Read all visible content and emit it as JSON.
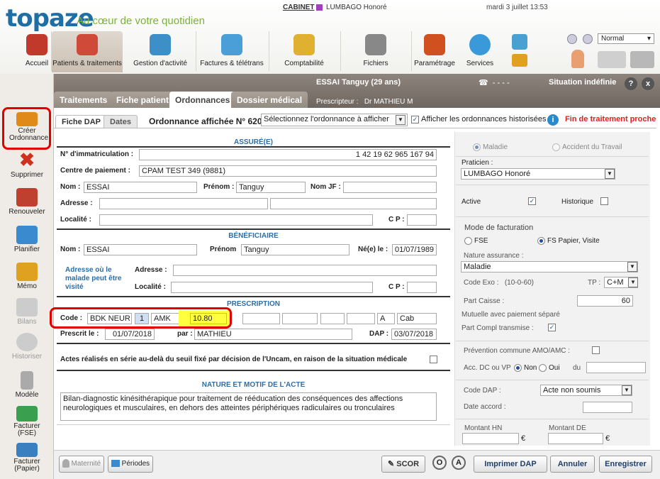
{
  "header": {
    "logo": "topaze",
    "tagline": "Au cœur de votre quotidien",
    "cabinet_label": "CABINET",
    "cabinet_user": "LUMBAGO Honoré",
    "date": "mardi 3 juillet 13:53",
    "mode": "Normal",
    "nav": [
      {
        "label": "Accueil",
        "icon": "home-icon",
        "color": "#c0392b"
      },
      {
        "label": "Patients & traitements",
        "icon": "patients-icon",
        "color": "#d04a3a"
      },
      {
        "label": "Gestion d'activité",
        "icon": "pen-icon",
        "color": "#3c8fc7"
      },
      {
        "label": "Factures & télétrans",
        "icon": "invoices-icon",
        "color": "#4a9fd8"
      },
      {
        "label": "Comptabilité",
        "icon": "accounting-icon",
        "color": "#e0b030"
      },
      {
        "label": "Fichiers",
        "icon": "files-icon",
        "color": "#888888"
      },
      {
        "label": "Paramétrage",
        "icon": "settings-icon",
        "color": "#d05020"
      },
      {
        "label": "Services",
        "icon": "globe-icon",
        "color": "#3a9ad9"
      }
    ]
  },
  "patient": {
    "name": "ESSAI Tanguy (29 ans)",
    "prescriber_label": "Prescripteur :",
    "prescriber": "Dr MATHIEU M",
    "phone": "- - - -",
    "situation": "Situation indéfinie",
    "help": "?",
    "close": "x"
  },
  "tabs": [
    "Traitements",
    "Fiche patient",
    "Ordonnances",
    "Dossier médical"
  ],
  "sidebar": [
    {
      "label": "Créer Ordonnance",
      "icon": "create-prescription-icon",
      "color": "#e08a1a"
    },
    {
      "label": "Supprimer",
      "icon": "delete-icon",
      "color": "#d03020"
    },
    {
      "label": "Renouveler",
      "icon": "renew-icon",
      "color": "#c04030"
    },
    {
      "label": "Planifier",
      "icon": "calendar-icon",
      "color": "#3a8ad0"
    },
    {
      "label": "Mémo",
      "icon": "memo-icon",
      "color": "#e0a020"
    },
    {
      "label": "Bilans",
      "icon": "reports-icon",
      "color": "#bbbbbb"
    },
    {
      "label": "Historiser",
      "icon": "history-icon",
      "color": "#bbbbbb"
    },
    {
      "label": "Modèle",
      "icon": "template-icon",
      "color": "#999999"
    },
    {
      "label": "Facturer (FSE)",
      "icon": "bill-fse-icon",
      "color": "#3aa050"
    },
    {
      "label": "Facturer (Papier)",
      "icon": "bill-paper-icon",
      "color": "#3a80c0"
    }
  ],
  "subtabs": [
    "Fiche DAP",
    "Dates"
  ],
  "ordonnance": {
    "title": "Ordonnance affichée N° 620",
    "select_placeholder": "Sélectionnez l'ordonnance à afficher",
    "show_history": "Afficher les ordonnances historisées",
    "warning": "Fin de traitement proche"
  },
  "assure": {
    "section": "ASSURÉ(E)",
    "immat_label": "N° d'immatriculation :",
    "immat": "1 42 19 62 965 167 94",
    "centre_label": "Centre de paiement :",
    "centre": "CPAM TEST 349 (9881)",
    "nom_label": "Nom :",
    "nom": "ESSAI",
    "prenom_label": "Prénom :",
    "prenom": "Tanguy",
    "nomjf_label": "Nom JF :",
    "nomjf": "",
    "adresse_label": "Adresse :",
    "localite_label": "Localité :",
    "cp_label": "C P :"
  },
  "beneficiaire": {
    "section": "BÉNÉFICIAIRE",
    "nom_label": "Nom :",
    "nom": "ESSAI",
    "prenom_label": "Prénom",
    "prenom": "Tanguy",
    "nele_label": "Né(e) le :",
    "nele": "01/07/1989",
    "where_label": "Adresse où le malade peut être visité",
    "adresse_label": "Adresse :",
    "localite_label": "Localité :",
    "cp_label": "C P :"
  },
  "prescription": {
    "section": "PRESCRIPTION",
    "code_label": "Code :",
    "code": "BDK NEUR",
    "code_num": "1",
    "amk": "AMK",
    "amount": "10.80",
    "a": "A",
    "cab": "Cab",
    "prescrit_label": "Prescrit le :",
    "prescrit": "01/07/2018",
    "par_label": "par :",
    "par": "MATHIEU",
    "dap_label": "DAP :",
    "dap": "03/07/2018",
    "serie": "Actes réalisés en série au-delà du seuil fixé par décision de l'Uncam, en raison de la situation médicale"
  },
  "nature": {
    "section": "NATURE ET MOTIF DE L'ACTE",
    "text": "Bilan-diagnostic kinésithérapique pour traitement de rééducation des conséquences des affections neurologiques et musculaires, en dehors des atteintes périphériques radiculaires ou tronculaires"
  },
  "right": {
    "maladie": "Maladie",
    "accident": "Accident du Travail",
    "praticien_label": "Praticien :",
    "praticien": "LUMBAGO Honoré",
    "active": "Active",
    "historique": "Historique",
    "mode_fact": "Mode de facturation",
    "fse": "FSE",
    "fs_papier": "FS Papier, Visite",
    "nature_label": "Nature assurance :",
    "nature": "Maladie",
    "code_exo_label": "Code Exo :",
    "code_exo": "(10-0-60)",
    "tp_label": "TP :",
    "tp": "C+M",
    "part_caisse_label": "Part Caisse :",
    "part_caisse": "60",
    "mutuelle": "Mutuelle avec paiement séparé",
    "part_compl": "Part Compl transmise :",
    "prevention": "Prévention commune AMO/AMC :",
    "acc_label": "Acc. DC ou VP",
    "non": "Non",
    "oui": "Oui",
    "du": "du",
    "code_dap_label": "Code DAP :",
    "code_dap": "Acte non soumis",
    "date_accord_label": "Date accord :",
    "montant_hn": "Montant HN",
    "montant_de": "Montant DE",
    "euro": "€"
  },
  "footer": {
    "maternite": "Maternité",
    "periodes": "Périodes",
    "scor": "SCOR",
    "o": "O",
    "a": "A",
    "imprimer": "Imprimer DAP",
    "annuler": "Annuler",
    "enregistrer": "Enregistrer"
  }
}
